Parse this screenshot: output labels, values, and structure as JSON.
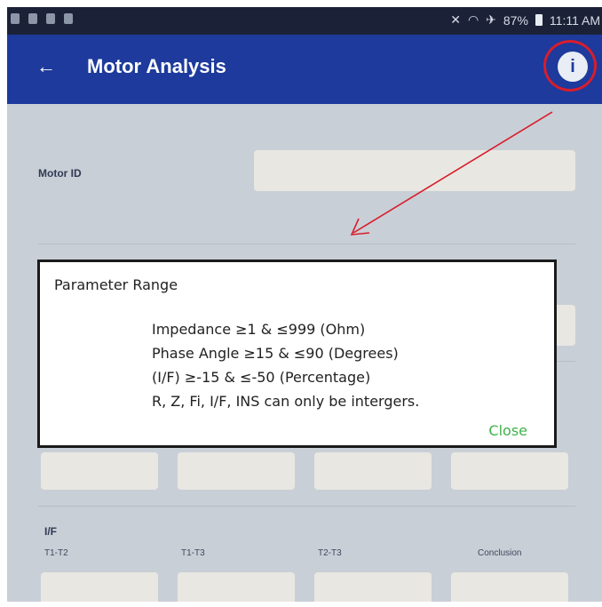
{
  "status_bar": {
    "battery_text": "87%",
    "time": "11:11 AM"
  },
  "app_bar": {
    "title": "Motor Analysis",
    "back_icon": "arrow-left-icon",
    "info_icon": "info-icon",
    "info_glyph": "i",
    "highlight_color": "#d81d2c"
  },
  "form": {
    "motor_id_label": "Motor ID",
    "motor_id_value": "",
    "if_section_label": "I/F",
    "columns": [
      "T1-T2",
      "T1-T3",
      "T2-T3",
      "Conclusion"
    ]
  },
  "dialog": {
    "title": "Parameter Range",
    "lines": [
      "Impedance ≥1 & ≤999 (Ohm)",
      "Phase Angle ≥15 & ≤90 (Degrees)",
      "(I/F) ≥-15 &  ≤-50 (Percentage)",
      "R, Z, Fi, I/F, INS can only be intergers."
    ],
    "close_label": "Close",
    "close_color": "#3fb24a"
  },
  "colors": {
    "app_bar": "#1d3a9c",
    "status_bar": "#1b2238",
    "annotation": "#d81d2c"
  }
}
